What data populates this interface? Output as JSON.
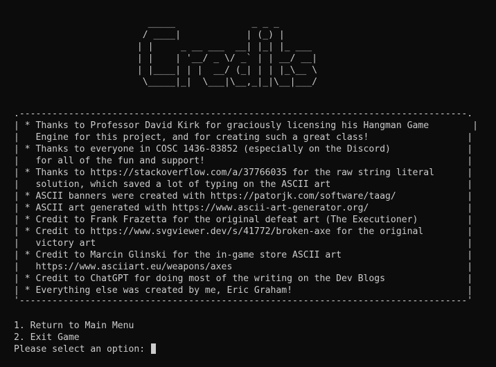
{
  "banner_art": "   _____              _ _ _       \n  / ____|            | (_) |      \n | |     _ __ ___  __| |_| |_ ___ \n | |    | '__/ _ \\/ _` | | __/ __|\n | |____| | |  __/ (_| | | |_\\__ \\\n  \\_____|_|  \\___|\\__,_|_|\\__|___/",
  "credits_box": {
    "top_border": ".----------------------------------------------------------------------------------.",
    "lines": [
      "| * Thanks to Professor David Kirk for graciously licensing his Hangman Game        |",
      "|   Engine for this project, and for creating such a great class!                  |",
      "| * Thanks to everyone in COSC 1436-83852 (especially on the Discord)              |",
      "|   for all of the fun and support!                                                |",
      "| * Thanks to https://stackoverflow.com/a/37766035 for the raw string literal      |",
      "|   solution, which saved a lot of typing on the ASCII art                         |",
      "| * ASCII banners were created with https://patorjk.com/software/taag/             |",
      "| * ASCII art generated with https://www.ascii-art-generator.org/                  |",
      "| * Credit to Frank Frazetta for the original defeat art (The Executioner)         |",
      "| * Credit to https://www.svgviewer.dev/s/41772/broken-axe for the original        |",
      "|   victory art                                                                    |",
      "| * Credit to Marcin Glinski for the in-game store ASCII art                       |",
      "|   https://www.asciiart.eu/weapons/axes                                           |",
      "| * Credit to ChatGPT for doing most of the writing on the Dev Blogs               |",
      "| * Everything else was created by me, Eric Graham!                                |"
    ],
    "bottom_border": "'----------------------------------------------------------------------------------'"
  },
  "menu": {
    "options": [
      "1. Return to Main Menu",
      "2. Exit Game"
    ],
    "prompt": "Please select an option: "
  },
  "colors": {
    "background": "#0c0c0c",
    "foreground": "#cccccc"
  }
}
